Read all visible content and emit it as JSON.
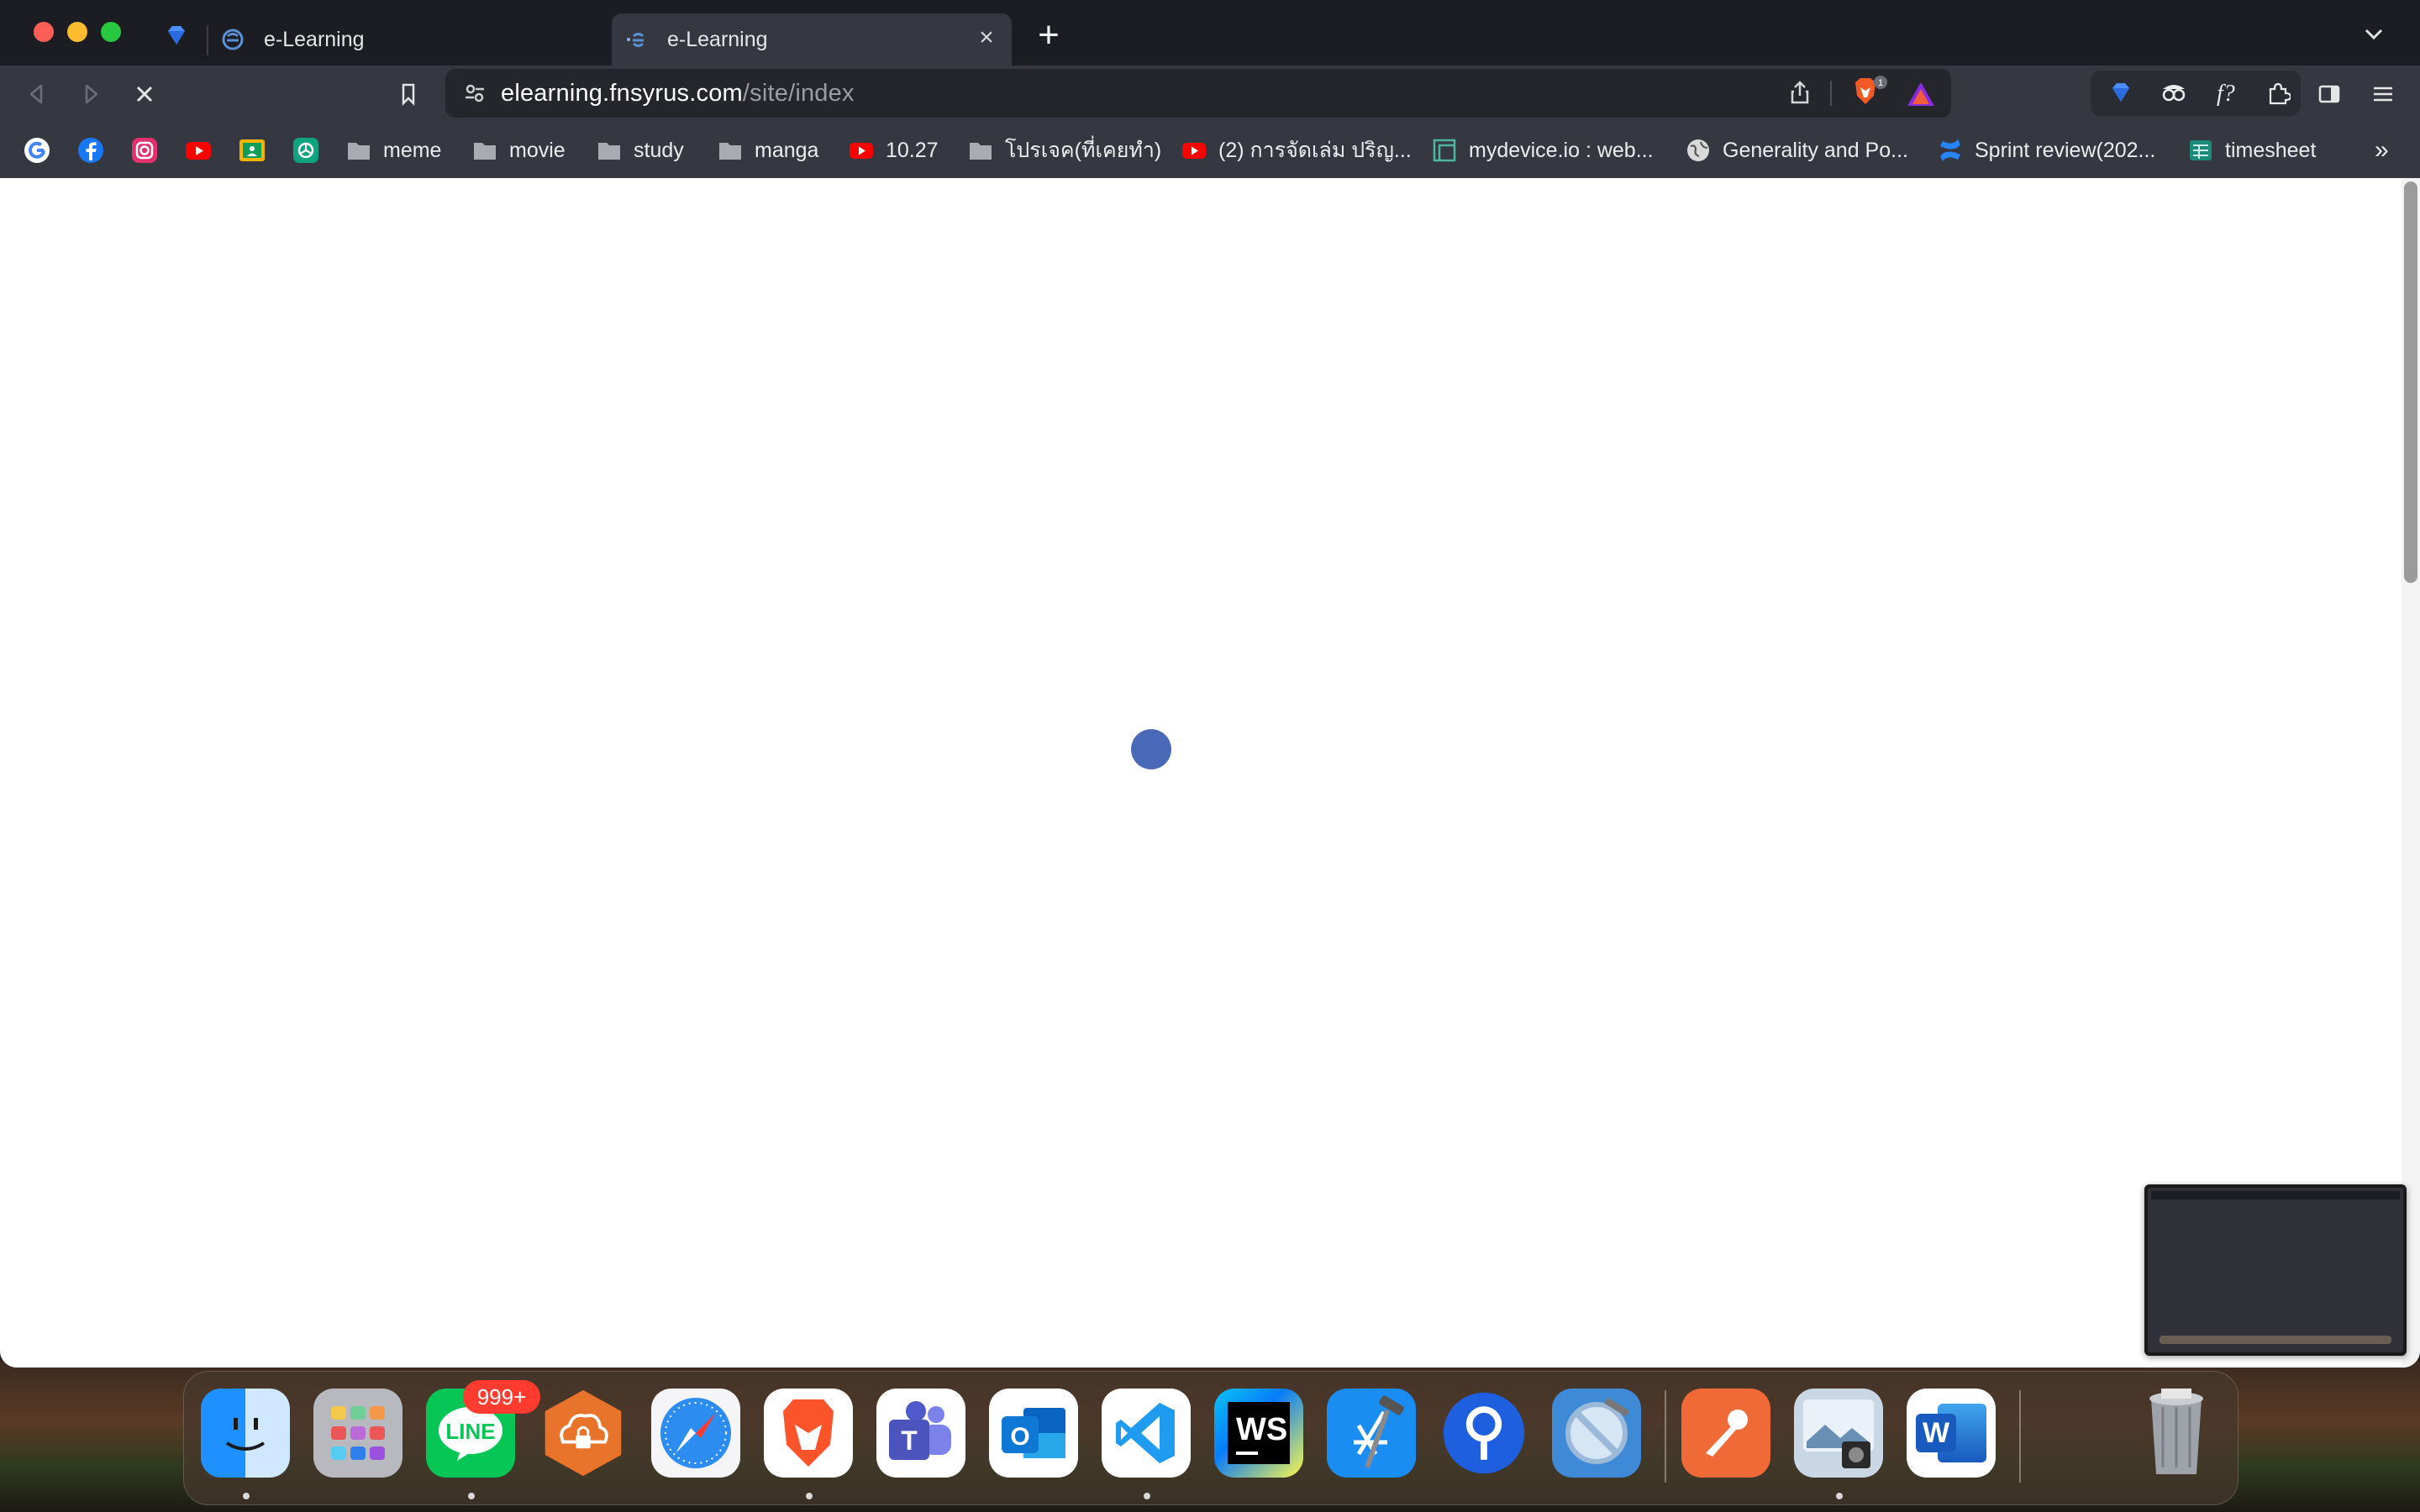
{
  "browser": {
    "tabs": [
      {
        "title": "e-Learning",
        "active": false
      },
      {
        "title": "e-Learning",
        "active": true
      }
    ],
    "url_host": "elearning.fnsyrus.com",
    "url_path": "/site/index",
    "shield_count": "1"
  },
  "bookmarks": [
    {
      "label": "",
      "icon": "google-icon"
    },
    {
      "label": "",
      "icon": "facebook-icon"
    },
    {
      "label": "",
      "icon": "instagram-icon"
    },
    {
      "label": "",
      "icon": "youtube-icon"
    },
    {
      "label": "",
      "icon": "classroom-icon"
    },
    {
      "label": "",
      "icon": "chatgpt-icon"
    },
    {
      "label": "meme",
      "icon": "folder-icon"
    },
    {
      "label": "movie",
      "icon": "folder-icon"
    },
    {
      "label": "study",
      "icon": "folder-icon"
    },
    {
      "label": "manga",
      "icon": "folder-icon"
    },
    {
      "label": "10.27",
      "icon": "youtube-icon"
    },
    {
      "label": "โปรเจค(ที่เคยทำ)",
      "icon": "folder-icon"
    },
    {
      "label": "(2) การจัดเล่ม ปริญ...",
      "icon": "youtube-icon"
    },
    {
      "label": "mydevice.io : web...",
      "icon": "mydevice-icon"
    },
    {
      "label": "Generality and Po...",
      "icon": "globe-icon"
    },
    {
      "label": "Sprint review(202...",
      "icon": "confluence-icon"
    },
    {
      "label": "timesheet",
      "icon": "sheet-icon"
    }
  ],
  "bookmarks_overflow": "»",
  "dock": {
    "line_badge": "999+",
    "apps": [
      "Finder",
      "Launchpad",
      "LINE",
      "Cloud Lock",
      "Safari",
      "Brave",
      "Teams",
      "Outlook",
      "VS Code",
      "WebStorm",
      "Xcode",
      "Proxyman",
      "Simulator",
      "Postman",
      "Preview",
      "Word",
      "Trash"
    ],
    "ws_label": "WS",
    "word_label": "W",
    "outlook_label": "O"
  },
  "colors": {
    "chrome_bg": "#1b1d22",
    "toolbar_bg": "#353841",
    "spinner": "#4a6ab9"
  }
}
